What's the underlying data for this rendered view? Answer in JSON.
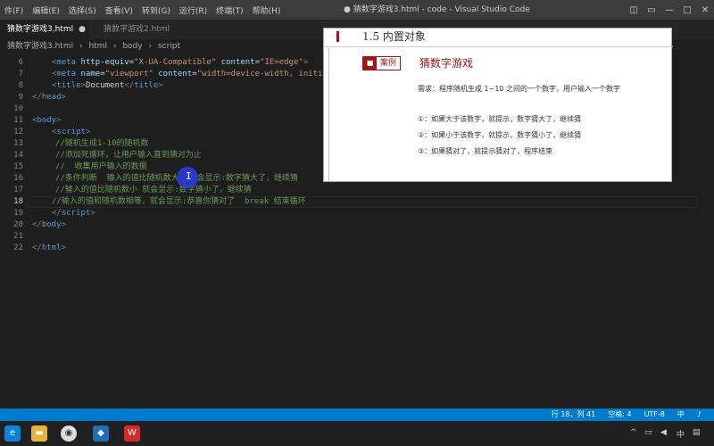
{
  "menu": [
    "件(F)",
    "编辑(E)",
    "选择(S)",
    "查看(V)",
    "转到(G)",
    "运行(R)",
    "终端(T)",
    "帮助(H)"
  ],
  "window_title": "● 猜数字游戏3.html - code - Visual Studio Code",
  "window_controls": [
    "◫",
    "▭",
    "—",
    "□",
    "✕"
  ],
  "tabs": [
    {
      "label": "猜数字游戏3.html",
      "dirty": "●"
    },
    {
      "label": "猜数字游戏2.html"
    }
  ],
  "breadcrumb": [
    "猜数字游戏3.html",
    "›",
    "html",
    "›",
    "body",
    "›",
    "script"
  ],
  "lines": [
    {
      "num": "6"
    },
    {
      "num": "7"
    },
    {
      "num": "8"
    },
    {
      "num": "9"
    },
    {
      "num": "10"
    },
    {
      "num": "11"
    },
    {
      "num": "12"
    },
    {
      "num": "13"
    },
    {
      "num": "14"
    },
    {
      "num": "15"
    },
    {
      "num": "16"
    },
    {
      "num": "17"
    },
    {
      "num": "18"
    },
    {
      "num": "19"
    },
    {
      "num": "20"
    },
    {
      "num": "21"
    },
    {
      "num": "22"
    }
  ],
  "code": {
    "l6_meta": "meta",
    "l6_attr1": "http-equiv",
    "l6_val1": "\"X-UA-Compatible\"",
    "l6_attr2": "content",
    "l6_val2": "\"IE=edge\"",
    "l7_meta": "meta",
    "l7_attr1": "name",
    "l7_val1": "\"viewport\"",
    "l7_attr2": "content",
    "l7_val2": "\"width=device-width, initia",
    "l8_tag": "title",
    "l8_text": "Document",
    "l9_tag": "head",
    "l11_tag": "body",
    "l12_tag": "script",
    "l13": "//随机生成1-10的随机数",
    "l14": "//添加死循环，让用户输入直到猜对为止",
    "l15": "//  收集用户输入的数据",
    "l16": "//条件判断  输入的值比随机数大  就会显示:数字猜大了，继续猜",
    "l17": "//输入的值比随机数小 就会显示:数字猜小了，继续猜",
    "l18": "//输入的值和随机数相等，就会显示:恭喜你猜对了  break 结束循环",
    "l19_tag": "script",
    "l20_tag": "body",
    "l22_tag": "html"
  },
  "slide": {
    "heading": "1.5 内置对象",
    "case_label": "案例",
    "case_title": "猜数字游戏",
    "requirement": "需求：程序随机生成 1~10 之间的一个数字，用户输入一个数字",
    "items": [
      "①：如果大于该数字，就提示，数字猜大了，继续猜",
      "②：如果小于该数字，就提示，数字猜小了，继续猜",
      "③：如果猜对了，就提示猜对了，程序结束"
    ]
  },
  "status": {
    "position": "行 18，列 41",
    "spaces": "空格: 4",
    "encoding": "UTF-8",
    "ime": "中",
    "extra": "♪"
  },
  "taskbar": {
    "wps_label": "W"
  },
  "colors": {
    "accent": "#007acc",
    "slide_red": "#a31515"
  }
}
